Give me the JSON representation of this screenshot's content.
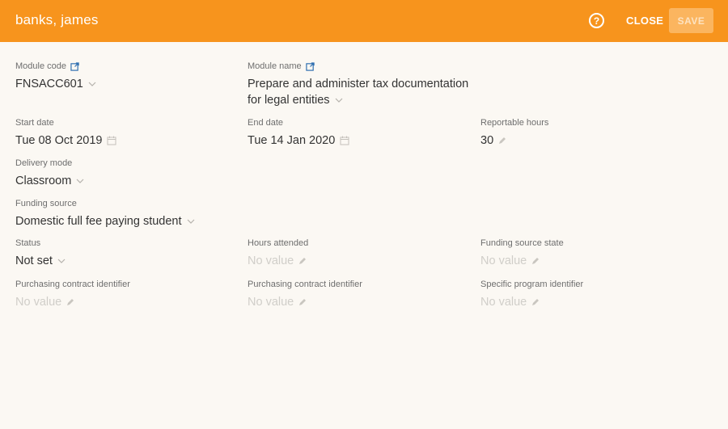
{
  "header": {
    "title": "banks, james",
    "help_glyph": "?",
    "close_label": "CLOSE",
    "save_label": "SAVE"
  },
  "colors": {
    "header_bg": "#f7941d",
    "save_bg": "#fbb55f",
    "page_bg": "#fbf8f3",
    "link_icon": "#2f6fb0"
  },
  "fields": {
    "module_code": {
      "label": "Module code",
      "value": "FNSACC601",
      "icon": "external-link-icon"
    },
    "module_name": {
      "label": "Module name",
      "value_line1": "Prepare and administer tax documentation",
      "value_line2": "for legal entities",
      "icon": "external-link-icon"
    },
    "start_date": {
      "label": "Start date",
      "value": "Tue 08 Oct 2019"
    },
    "end_date": {
      "label": "End date",
      "value": "Tue 14 Jan 2020"
    },
    "reportable_hours": {
      "label": "Reportable hours",
      "value": "30"
    },
    "delivery_mode": {
      "label": "Delivery mode",
      "value": "Classroom"
    },
    "funding_source": {
      "label": "Funding source",
      "value": "Domestic full fee paying student"
    },
    "status": {
      "label": "Status",
      "value": "Not set"
    },
    "hours_attended": {
      "label": "Hours attended",
      "value": "No value"
    },
    "funding_source_state": {
      "label": "Funding source state",
      "value": "No value"
    },
    "purchasing_contract_1": {
      "label": "Purchasing contract identifier",
      "value": "No value"
    },
    "purchasing_contract_2": {
      "label": "Purchasing contract identifier",
      "value": "No value"
    },
    "specific_program": {
      "label": "Specific program identifier",
      "value": "No value"
    }
  }
}
